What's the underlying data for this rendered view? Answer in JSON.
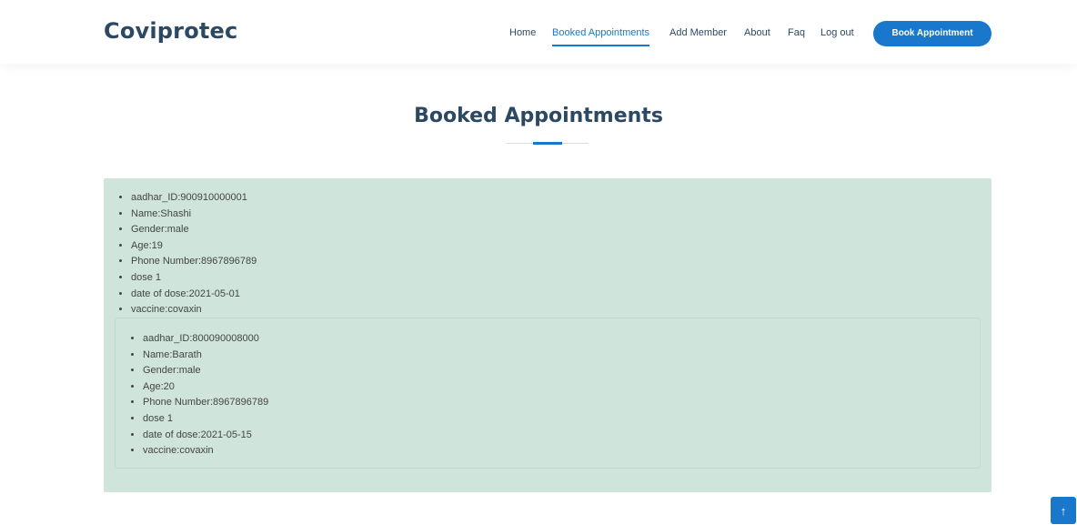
{
  "brand": {
    "logo": "Coviprotec"
  },
  "nav": {
    "items": [
      {
        "label": "Home",
        "active": false
      },
      {
        "label": "Booked Appointments",
        "active": true
      },
      {
        "label": "Add Member",
        "active": false
      },
      {
        "label": "About",
        "active": false
      },
      {
        "label": "Faq",
        "active": false
      },
      {
        "label": "Log out",
        "active": false
      }
    ],
    "cta_label": "Book Appointment"
  },
  "section": {
    "title": "Booked Appointments"
  },
  "appointments": [
    {
      "fields": [
        "aadhar_ID:900910000001",
        "Name:Shashi",
        "Gender:male",
        "Age:19",
        "Phone Number:8967896789",
        "dose 1",
        "date of dose:2021-05-01",
        "vaccine:covaxin"
      ]
    },
    {
      "fields": [
        "aadhar_ID:800090008000",
        "Name:Barath",
        "Gender:male",
        "Age:20",
        "Phone Number:8967896789",
        "dose 1",
        "date of dose:2021-05-15",
        "vaccine:covaxin"
      ]
    }
  ],
  "scroll_top": {
    "icon": "arrow-up-icon",
    "glyph": "↑"
  },
  "colors": {
    "accent": "#1977cc",
    "heading": "#2c4964",
    "card_bg": "#cfe5db"
  }
}
